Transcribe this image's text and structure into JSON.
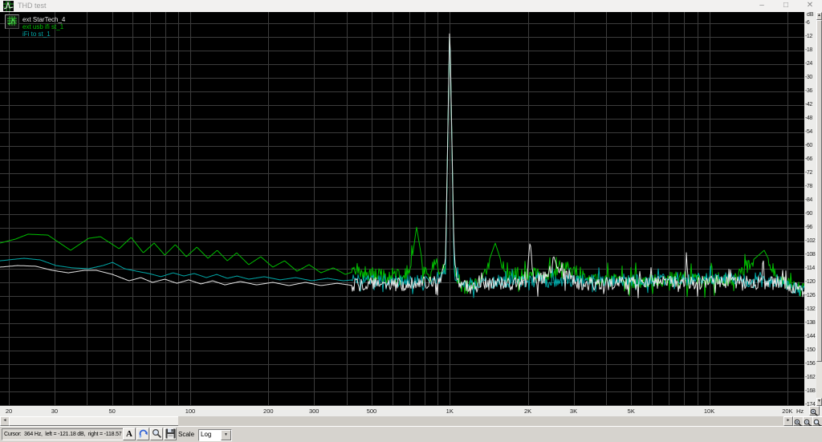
{
  "window": {
    "title": "THD test",
    "controls": {
      "minimize": "–",
      "maximize": "□",
      "close": "✕"
    }
  },
  "legend": {
    "items": [
      {
        "label": "ext StarTech_4",
        "color": "#e6e6e6"
      },
      {
        "label": "ext usb ifi st_1",
        "color": "#00be00"
      },
      {
        "label": "iFi to st_1",
        "color": "#00a8a8"
      }
    ]
  },
  "axes": {
    "y_unit": "dB",
    "x_unit": "Hz",
    "db_max": -6,
    "db_min": -174,
    "db_step": 6,
    "freq_ticks": [
      {
        "f": 20,
        "label": "20"
      },
      {
        "f": 30,
        "label": "30"
      },
      {
        "f": 50,
        "label": "50"
      },
      {
        "f": 100,
        "label": "100"
      },
      {
        "f": 200,
        "label": "200"
      },
      {
        "f": 300,
        "label": "300"
      },
      {
        "f": 500,
        "label": "500"
      },
      {
        "f": 1000,
        "label": "1K"
      },
      {
        "f": 2000,
        "label": "2K"
      },
      {
        "f": 3000,
        "label": "3K"
      },
      {
        "f": 5000,
        "label": "5K"
      },
      {
        "f": 10000,
        "label": "10K"
      },
      {
        "f": 20000,
        "label": "20K"
      }
    ]
  },
  "chart_data": {
    "type": "line",
    "title": "THD test",
    "xlabel": "Hz",
    "ylabel": "dB",
    "x_scale": "log",
    "xlim": [
      20,
      23000
    ],
    "ylim": [
      -174,
      -6
    ],
    "grid": true,
    "fundamental": {
      "f": 1000,
      "db": -5.0
    },
    "series": [
      {
        "name": "ext usb ifi st_1",
        "color": "#00be00",
        "noise": {
          "start_hz": 420,
          "amp_db": 3.4,
          "spike_amp_db": 8,
          "spike_prob": 0.1,
          "seed": 7
        },
        "points": [
          [
            18.5,
            -102.7
          ],
          [
            21.3,
            -100.9
          ],
          [
            23.7,
            -98.8
          ],
          [
            28.3,
            -99.2
          ],
          [
            34.6,
            -105.9
          ],
          [
            40.6,
            -100.6
          ],
          [
            45.1,
            -99.9
          ],
          [
            53.2,
            -105.2
          ],
          [
            59.2,
            -100.2
          ],
          [
            65.9,
            -107.0
          ],
          [
            72.6,
            -102.7
          ],
          [
            79.8,
            -108.0
          ],
          [
            87.6,
            -103.4
          ],
          [
            96.6,
            -108.7
          ],
          [
            106,
            -104.5
          ],
          [
            117,
            -109.4
          ],
          [
            127,
            -105.9
          ],
          [
            139,
            -110.5
          ],
          [
            151,
            -107.0
          ],
          [
            168,
            -112.2
          ],
          [
            187,
            -108.7
          ],
          [
            208,
            -113.3
          ],
          [
            231,
            -110.5
          ],
          [
            258,
            -115.1
          ],
          [
            287,
            -112.2
          ],
          [
            319,
            -115.8
          ],
          [
            356,
            -113.6
          ],
          [
            396,
            -116.5
          ],
          [
            441,
            -114.7
          ],
          [
            491,
            -117.5
          ],
          [
            529,
            -115.8
          ],
          [
            569,
            -118.2
          ],
          [
            613,
            -116.5
          ],
          [
            660,
            -119.3
          ],
          [
            711,
            -112.2
          ],
          [
            745,
            -95.6
          ],
          [
            787,
            -112.2
          ],
          [
            832,
            -119.3
          ],
          [
            880,
            -110.5
          ],
          [
            924,
            -117.5
          ],
          [
            963,
            -113.0
          ],
          [
            1000,
            -6.5
          ],
          [
            1040,
            -113.0
          ],
          [
            1110,
            -122.1
          ],
          [
            1330,
            -119.3
          ],
          [
            1497,
            -102.7
          ],
          [
            1650,
            -117.5
          ],
          [
            2040,
            -115.8
          ],
          [
            2350,
            -117.5
          ],
          [
            2730,
            -112.2
          ],
          [
            2890,
            -113.3
          ],
          [
            3390,
            -118.6
          ],
          [
            4870,
            -119.3
          ],
          [
            8000,
            -118.6
          ],
          [
            12000,
            -119.0
          ],
          [
            16280,
            -105.9
          ],
          [
            18600,
            -119.3
          ],
          [
            21500,
            -122.1
          ],
          [
            23300,
            -123.5
          ]
        ]
      },
      {
        "name": "iFi to st_1",
        "color": "#00a8a8",
        "noise": {
          "start_hz": 420,
          "amp_db": 2.8,
          "spike_amp_db": 6,
          "spike_prob": 0.08,
          "seed": 13
        },
        "points": [
          [
            18.5,
            -110.5
          ],
          [
            22.9,
            -109.4
          ],
          [
            26.4,
            -110.1
          ],
          [
            30.4,
            -112.6
          ],
          [
            35.1,
            -113.6
          ],
          [
            40.6,
            -114.0
          ],
          [
            46.1,
            -112.6
          ],
          [
            50.2,
            -111.2
          ],
          [
            55.9,
            -114.0
          ],
          [
            62.2,
            -115.1
          ],
          [
            69.3,
            -116.1
          ],
          [
            77.1,
            -117.5
          ],
          [
            85.9,
            -115.8
          ],
          [
            94.4,
            -117.2
          ],
          [
            103.6,
            -116.1
          ],
          [
            115.4,
            -117.9
          ],
          [
            126.5,
            -116.5
          ],
          [
            139,
            -118.2
          ],
          [
            151.5,
            -117.2
          ],
          [
            168,
            -118.6
          ],
          [
            193,
            -117.5
          ],
          [
            222,
            -118.9
          ],
          [
            255,
            -117.9
          ],
          [
            294,
            -119.3
          ],
          [
            338,
            -118.2
          ],
          [
            389,
            -119.3
          ],
          [
            448,
            -118.6
          ],
          [
            515,
            -119.6
          ],
          [
            593,
            -118.9
          ],
          [
            740,
            -119.6
          ],
          [
            880,
            -118.9
          ],
          [
            963,
            -116.0
          ],
          [
            1000,
            -6.2
          ],
          [
            1040,
            -116.0
          ],
          [
            1145,
            -121.4
          ],
          [
            1520,
            -119.6
          ],
          [
            2730,
            -119.3
          ],
          [
            5600,
            -118.9
          ],
          [
            11300,
            -118.6
          ],
          [
            18600,
            -120.0
          ],
          [
            21500,
            -122.8
          ],
          [
            23300,
            -124.2
          ]
        ]
      },
      {
        "name": "ext StarTech_4",
        "color": "#e6e6e6",
        "noise": {
          "start_hz": 420,
          "amp_db": 3.0,
          "spike_amp_db": 7,
          "spike_prob": 0.09,
          "seed": 3
        },
        "points": [
          [
            18.5,
            -113.3
          ],
          [
            21.6,
            -112.6
          ],
          [
            25.4,
            -112.9
          ],
          [
            29.4,
            -114.7
          ],
          [
            33.9,
            -115.8
          ],
          [
            39.1,
            -114.7
          ],
          [
            43.5,
            -114.7
          ],
          [
            50.2,
            -116.5
          ],
          [
            58.1,
            -119.3
          ],
          [
            64.5,
            -117.9
          ],
          [
            71.5,
            -120.0
          ],
          [
            79.8,
            -118.6
          ],
          [
            88.9,
            -120.4
          ],
          [
            98.7,
            -118.9
          ],
          [
            110,
            -120.7
          ],
          [
            122,
            -119.3
          ],
          [
            136,
            -121.1
          ],
          [
            156,
            -119.6
          ],
          [
            180,
            -121.1
          ],
          [
            208,
            -120.0
          ],
          [
            240,
            -121.4
          ],
          [
            278,
            -120.0
          ],
          [
            319,
            -121.4
          ],
          [
            368,
            -120.4
          ],
          [
            426,
            -121.4
          ],
          [
            491,
            -120.4
          ],
          [
            569,
            -121.4
          ],
          [
            660,
            -120.7
          ],
          [
            800,
            -120.0
          ],
          [
            924,
            -118.6
          ],
          [
            963,
            -112.2
          ],
          [
            1000,
            -5.0
          ],
          [
            1040,
            -112.2
          ],
          [
            1085,
            -120.0
          ],
          [
            1185,
            -122.1
          ],
          [
            1430,
            -120.7
          ],
          [
            1970,
            -120.4
          ],
          [
            2040,
            -101.6
          ],
          [
            2110,
            -120.4
          ],
          [
            2430,
            -115.8
          ],
          [
            2520,
            -108.7
          ],
          [
            2610,
            -115.1
          ],
          [
            3160,
            -120.7
          ],
          [
            5600,
            -120.0
          ],
          [
            8070,
            -120.4
          ],
          [
            8170,
            -105.2
          ],
          [
            8260,
            -120.4
          ],
          [
            11300,
            -119.6
          ],
          [
            15900,
            -120.4
          ],
          [
            16100,
            -107.6
          ],
          [
            16400,
            -120.4
          ],
          [
            19300,
            -120.4
          ],
          [
            21500,
            -122.8
          ],
          [
            23300,
            -124.9
          ]
        ]
      }
    ]
  },
  "statusbar": {
    "cursor_text": "Cursor:  364 Hz,  left = -121.18 dB,  right = -118.57 dB",
    "font_button": "A",
    "scale_label": "Scale",
    "scale_value": "Log"
  },
  "scrollbars": {
    "up": "▲",
    "down": "▼",
    "left": "◄",
    "right": "►",
    "drop": "▼"
  }
}
